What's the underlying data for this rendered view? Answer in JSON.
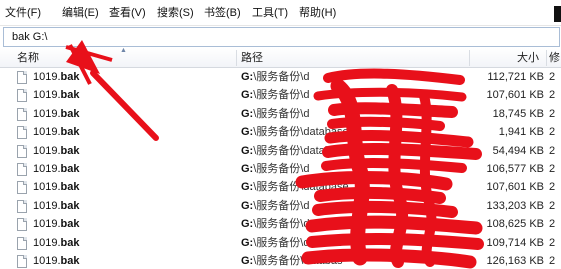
{
  "menu": [
    {
      "label": "文件(F)"
    },
    {
      "label": "编辑(E)"
    },
    {
      "label": "查看(V)"
    },
    {
      "label": "搜索(S)"
    },
    {
      "label": "书签(B)"
    },
    {
      "label": "工具(T)"
    },
    {
      "label": "帮助(H)"
    }
  ],
  "search": {
    "value": "bak G:\\"
  },
  "columns": {
    "name": "名称",
    "path": "路径",
    "size": "大小",
    "extra": "修"
  },
  "rows": [
    {
      "name": "1019.",
      "ext": "bak",
      "drive": "G:",
      "path": "\\服务备份\\d",
      "size": "112,721 KB",
      "extra": "2"
    },
    {
      "name": "1019.",
      "ext": "bak",
      "drive": "G:",
      "path": "\\服务备份\\d",
      "size": "107,601 KB",
      "extra": "2"
    },
    {
      "name": "1019.",
      "ext": "bak",
      "drive": "G:",
      "path": "\\服务备份\\d",
      "size": "18,745 KB",
      "extra": "2"
    },
    {
      "name": "1019.",
      "ext": "bak",
      "drive": "G:",
      "path": "\\服务备份\\database",
      "size": "1,941 KB",
      "extra": "2"
    },
    {
      "name": "1019.",
      "ext": "bak",
      "drive": "G:",
      "path": "\\服务备份\\database",
      "size": "54,494 KB",
      "extra": "2"
    },
    {
      "name": "1019.",
      "ext": "bak",
      "drive": "G:",
      "path": "\\服务备份\\d",
      "size": "106,577 KB",
      "extra": "2"
    },
    {
      "name": "1019.",
      "ext": "bak",
      "drive": "G:",
      "path": "\\服务备份\\database",
      "size": "107,601 KB",
      "extra": "2"
    },
    {
      "name": "1019.",
      "ext": "bak",
      "drive": "G:",
      "path": "\\服务备份\\d",
      "size": "133,203 KB",
      "extra": "2"
    },
    {
      "name": "1019.",
      "ext": "bak",
      "drive": "G:",
      "path": "\\服务备份\\d",
      "size": "108,625 KB",
      "extra": "2"
    },
    {
      "name": "1019.",
      "ext": "bak",
      "drive": "G:",
      "path": "\\服务备份\\databas",
      "size": "109,714 KB",
      "extra": "2"
    },
    {
      "name": "1019.",
      "ext": "bak",
      "drive": "G:",
      "path": "\\服务备份\\databas",
      "size": "126,163 KB",
      "extra": "2"
    }
  ],
  "colors": {
    "annotation": "#e8101a",
    "searchBorder": "#a9bdd6"
  }
}
